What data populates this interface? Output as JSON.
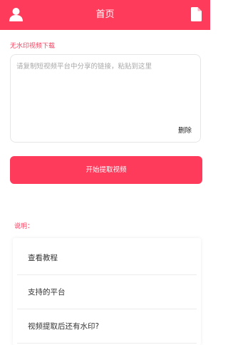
{
  "header": {
    "title": "首页",
    "user_icon": "user-icon",
    "doc_icon": "document-icon",
    "bg_color": "#ff3b5c"
  },
  "form": {
    "section_label": "无水印视频下载",
    "placeholder": "请复制短视频平台中分享的链接，粘贴到这里",
    "delete_label": "删除",
    "submit_label": "开始提取视频"
  },
  "notes": {
    "label": "说明：",
    "items": [
      {
        "label": "查看教程"
      },
      {
        "label": "支持的平台"
      },
      {
        "label": "视频提取后还有水印?"
      }
    ]
  }
}
